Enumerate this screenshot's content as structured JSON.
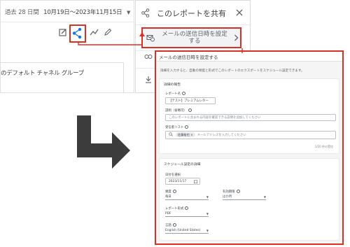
{
  "report": {
    "date_prefix": "過去 28 日間",
    "date_range": "10月19日～2023年11月15日",
    "card_title": "のデフォルト チャネル グループ"
  },
  "share_panel": {
    "title": "このレポートを共有",
    "schedule_button_label": "メールの送信日時を設定する"
  },
  "dialog": {
    "title": "メールの送信日時を設定する",
    "description": "詳細を入力すると、自動の頻度と形式でこのレポートのエクスポートをスケジュール設定できます。",
    "report_details": {
      "section_title": "詳細の報告",
      "report_name_label": "レポート名",
      "report_name_value": "【テスト】プレミアムレター",
      "description_label": "説明（省略可）",
      "description_placeholder": "このレポートに含まれる内容を確認できる説明を追加してください",
      "recipients_label": "受信者リスト",
      "recipient_chip": "佐藤裕也",
      "recipient_placeholder": "メールアドレスを入力してください",
      "recipient_count": "1/20 件の受信"
    },
    "schedule": {
      "section_title": "スケジュール設定の詳細",
      "start_date_label": "日付を選択",
      "start_date_value": "2023/11/17",
      "frequency_label": "頻度",
      "frequency_value": "毎日",
      "end_label": "有効期限",
      "end_value": "ほか月",
      "format_label": "レポート形式",
      "format_value": "PDF",
      "language_label": "言語",
      "language_value": "English (United States)"
    }
  },
  "colors": {
    "highlight": "#d93025",
    "share_blue": "#1a73e8",
    "arrow_grey": "#3c3c3c"
  }
}
